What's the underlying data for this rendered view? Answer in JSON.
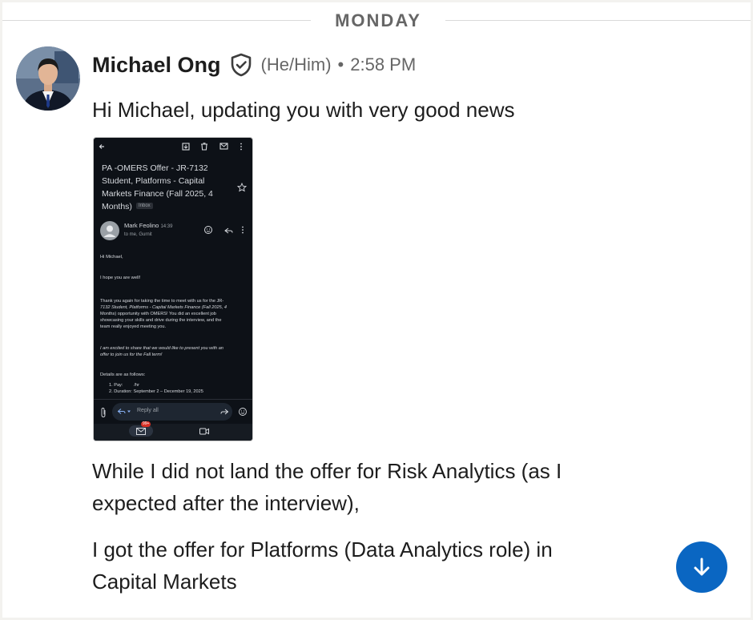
{
  "divider": {
    "label": "MONDAY"
  },
  "message": {
    "sender": "Michael Ong",
    "pronouns": "(He/Him)",
    "separator": "•",
    "time": "2:58 PM",
    "text1": "Hi Michael, updating you with very good news",
    "text2_line1": "While I did not land the offer for Risk Analytics (as I",
    "text2_line2": "expected after the interview),",
    "text3_line1": "I got the offer for Platforms (Data Analytics role) in",
    "text3_line2": "Capital Markets"
  },
  "attachment": {
    "subject_line1": "PA -OMERS Offer - JR-7132",
    "subject_line2": "Student, Platforms - Capital",
    "subject_line3": "Markets Finance (Fall 2025, 4",
    "subject_line4": "Months)",
    "inbox_tag": "Inbox",
    "from_name": "Mark Feolino",
    "from_time": "14:39",
    "to_line": "to me, Gurnit",
    "greeting": "Hi Michael,",
    "line_hope": "I hope you are well!",
    "p1_l1": "Thank you again for taking the time to meet with us for the JR-",
    "p1_l2": "7132 Student, Platforms - Capital Markets Finance (Fall 2025, 4",
    "p1_l3": "Months) opportunity with OMERS! You did an excellent job",
    "p1_l4": "showcasing your skills and drive during the interview, and the",
    "p1_l5": "team really enjoyed meeting you.",
    "p2_l1": "I am excited to share that we would like to present you with an",
    "p2_l2": "offer to join us for the Fall term!",
    "details": "Details are as follows:",
    "item1": "1. Pay:         /hr",
    "item2": "2. Duration: September 2 – December 19, 2025",
    "reply_placeholder": "Reply all",
    "mail_badge": "99+"
  },
  "colors": {
    "accent": "#0a66c2",
    "verified": "#3d3d3d"
  },
  "icons": [
    "verified-shield-icon",
    "arrow-down-icon"
  ]
}
